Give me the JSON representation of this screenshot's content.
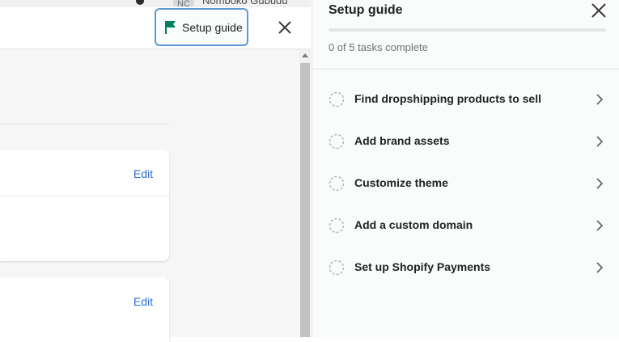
{
  "header": {
    "avatar_initials": "NC",
    "username": "Nomboko Gubudu",
    "setup_button_label": "Setup guide",
    "flag_icon": "flag-icon",
    "close_icon": "close-icon"
  },
  "content": {
    "cards": [
      {
        "edit_label": "Edit"
      },
      {
        "edit_label": "Edit"
      }
    ]
  },
  "panel": {
    "title": "Setup guide",
    "progress_text": "0 of 5 tasks complete",
    "progress_fraction": 0,
    "tasks": [
      {
        "label": "Find dropshipping products to sell",
        "status": "incomplete"
      },
      {
        "label": "Add brand assets",
        "status": "incomplete"
      },
      {
        "label": "Customize theme",
        "status": "incomplete"
      },
      {
        "label": "Add a custom domain",
        "status": "incomplete"
      },
      {
        "label": "Set up Shopify Payments",
        "status": "incomplete"
      }
    ]
  },
  "colors": {
    "accent": "#008060",
    "link": "#2c6ecb",
    "focus_ring": "#5b9bd5"
  }
}
